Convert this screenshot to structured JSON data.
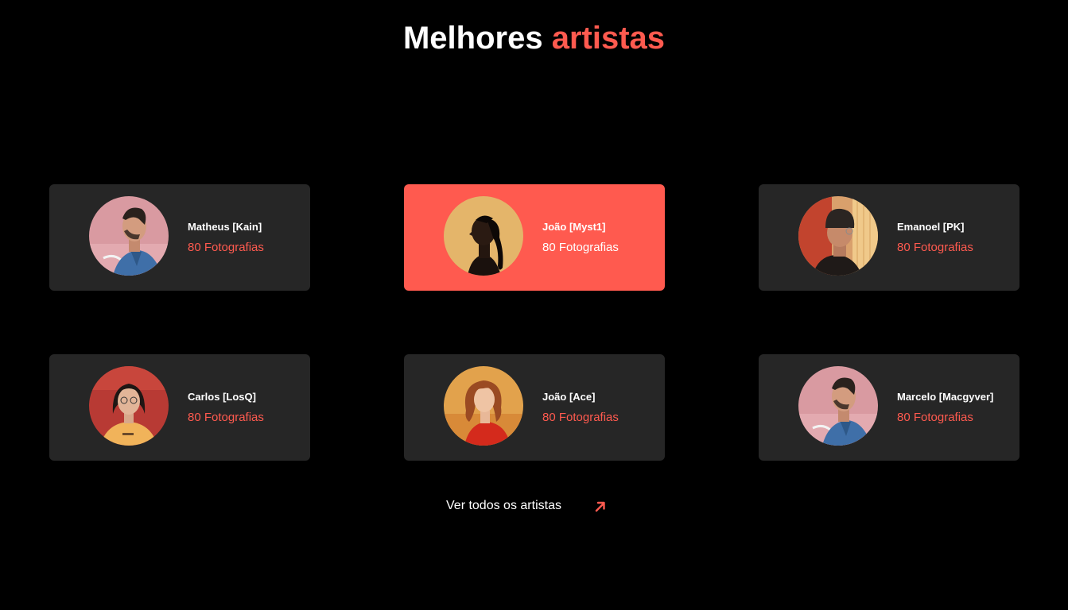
{
  "section": {
    "title_main": "Melhores",
    "title_accent": "artistas"
  },
  "colors": {
    "accent": "#ff5a4f",
    "card_bg": "#262626",
    "page_bg": "#000000"
  },
  "artists": [
    {
      "name": "Matheus [Kain]",
      "count": "80 Fotografias",
      "avatar": "man-profile-denim-pink-bg",
      "active": false
    },
    {
      "name": "João [Myst1]",
      "count": "80 Fotografias",
      "avatar": "woman-profile-ponytail-gold-bg",
      "active": true
    },
    {
      "name": "Emanoel [PK]",
      "count": "80 Fotografias",
      "avatar": "man-beanie-glasses-red-bg",
      "active": false
    },
    {
      "name": "Carlos [LosQ]",
      "count": "80 Fotografias",
      "avatar": "woman-glasses-yellow-shirt-red-bg",
      "active": false
    },
    {
      "name": "João [Ace]",
      "count": "80 Fotografias",
      "avatar": "woman-red-hair-red-top-orange-bg",
      "active": false
    },
    {
      "name": "Marcelo [Macgyver]",
      "count": "80 Fotografias",
      "avatar": "man-profile-denim-pink-bg",
      "active": false
    }
  ],
  "see_all": {
    "label": "Ver todos os artistas",
    "icon": "arrow-up-right-icon"
  }
}
